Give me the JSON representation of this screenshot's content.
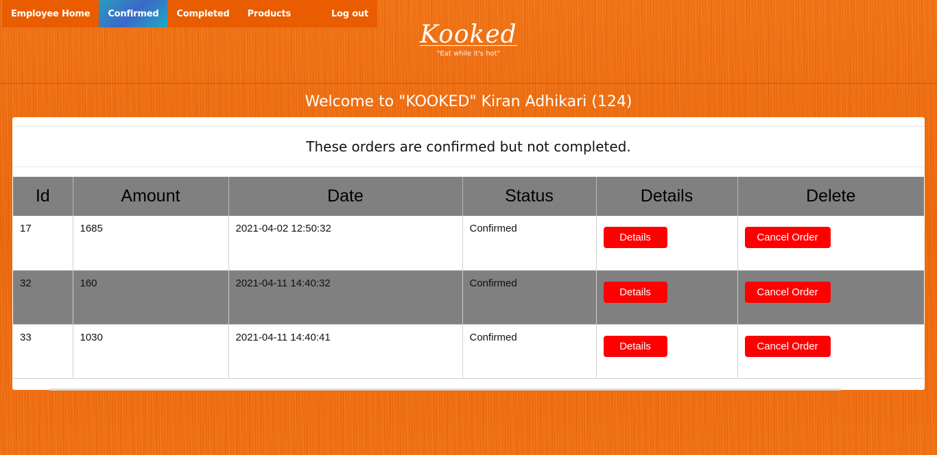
{
  "nav": {
    "items": [
      {
        "label": "Employee Home",
        "active": false
      },
      {
        "label": "Confirmed",
        "active": true
      },
      {
        "label": "Completed",
        "active": false
      },
      {
        "label": "Products",
        "active": false
      }
    ],
    "logout_label": "Log out"
  },
  "brand": {
    "logo_text": "Kooked",
    "tagline": "\"Eat while it's hot\""
  },
  "welcome_text": "Welcome to \"KOOKED\" Kiran Adhikari (124)",
  "panel": {
    "title": "These orders are confirmed but not completed."
  },
  "table": {
    "headers": [
      "Id",
      "Amount",
      "Date",
      "Status",
      "Details",
      "Delete"
    ],
    "rows": [
      {
        "id": "17",
        "amount": "1685",
        "date": "2021-04-02 12:50:32",
        "status": "Confirmed",
        "details_label": "Details",
        "delete_label": "Cancel Order"
      },
      {
        "id": "32",
        "amount": "160",
        "date": "2021-04-11 14:40:32",
        "status": "Confirmed",
        "details_label": "Details",
        "delete_label": "Cancel Order"
      },
      {
        "id": "33",
        "amount": "1030",
        "date": "2021-04-11 14:40:41",
        "status": "Confirmed",
        "details_label": "Details",
        "delete_label": "Cancel Order"
      }
    ]
  },
  "colors": {
    "background": "#f06a10",
    "navbar": "#e95c00",
    "header_gray": "#808080",
    "button_red": "#ff0000"
  }
}
